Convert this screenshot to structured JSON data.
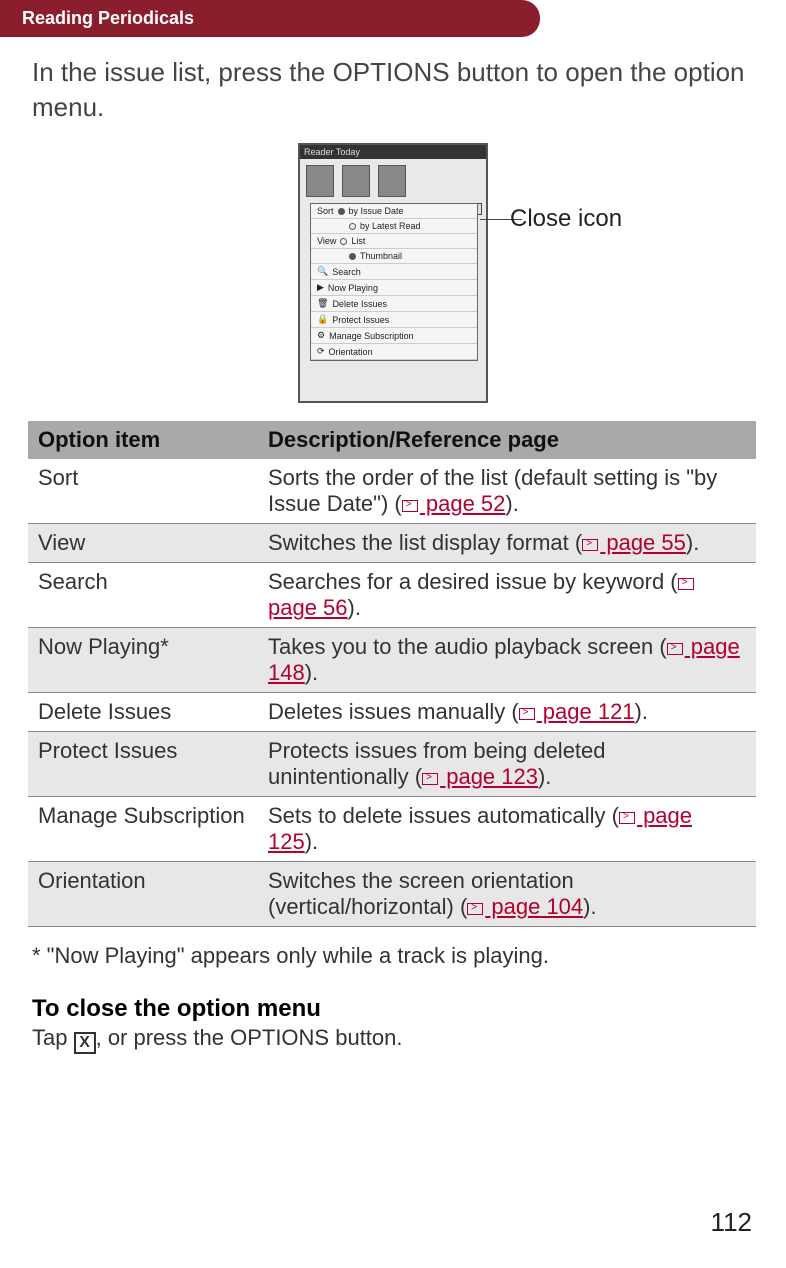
{
  "header": {
    "breadcrumb": "Reading Periodicals"
  },
  "intro": "In the issue list, press the OPTIONS button to open the option menu.",
  "callout": "Close icon",
  "screenshot": {
    "title": "Reader Today",
    "menu": {
      "sort_label": "Sort",
      "sort_opt1": "by Issue Date",
      "sort_opt2": "by Latest Read",
      "view_label": "View",
      "view_opt1": "List",
      "view_opt2": "Thumbnail",
      "search": "Search",
      "now_playing": "Now Playing",
      "delete": "Delete Issues",
      "protect": "Protect Issues",
      "manage": "Manage Subscription",
      "orientation": "Orientation"
    }
  },
  "table": {
    "head_option": "Option item",
    "head_desc": "Description/Reference page",
    "rows": [
      {
        "name": "Sort",
        "desc_pre": "Sorts the order of the list (default setting is \"by Issue Date\") (",
        "ref": "page 52",
        "desc_post": ").",
        "shade": false
      },
      {
        "name": "View",
        "desc_pre": "Switches the list display format (",
        "ref": "page 55",
        "desc_post": ").",
        "shade": true
      },
      {
        "name": "Search",
        "desc_pre": "Searches for a desired issue by keyword (",
        "ref": "page 56",
        "desc_post": ").",
        "shade": false
      },
      {
        "name": "Now Playing*",
        "desc_pre": "Takes you to the audio playback screen (",
        "ref": "page 148",
        "desc_post": ").",
        "shade": true
      },
      {
        "name": "Delete Issues",
        "desc_pre": "Deletes issues manually (",
        "ref": "page 121",
        "desc_post": ").",
        "shade": false
      },
      {
        "name": "Protect Issues",
        "desc_pre": "Protects issues from being deleted unintentionally (",
        "ref": "page 123",
        "desc_post": ").",
        "shade": true
      },
      {
        "name": "Manage Subscription",
        "desc_pre": "Sets to delete issues automatically (",
        "ref": "page 125",
        "desc_post": ").",
        "shade": false
      },
      {
        "name": "Orientation",
        "desc_pre": "Switches the screen orientation (vertical/horizontal) (",
        "ref": "page 104",
        "desc_post": ").",
        "shade": true
      }
    ]
  },
  "footnote": "* \"Now Playing\" appears only while a track is playing.",
  "close_section": {
    "heading": "To close the option menu",
    "pre": "Tap ",
    "x": "X",
    "post": ", or press the OPTIONS button."
  },
  "page_number": "112"
}
